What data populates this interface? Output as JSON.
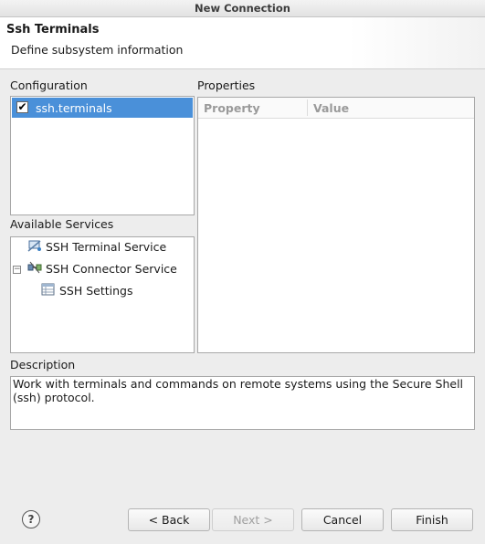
{
  "window": {
    "title": "New Connection"
  },
  "header": {
    "title": "Ssh Terminals",
    "subtitle": "Define subsystem information"
  },
  "configuration": {
    "label": "Configuration",
    "items": [
      {
        "label": "ssh.terminals",
        "checked": true,
        "selected": true
      }
    ]
  },
  "available_services": {
    "label": "Available Services",
    "items": [
      {
        "label": "SSH Terminal Service",
        "icon": "terminal-service-icon"
      },
      {
        "label": "SSH Connector Service",
        "icon": "connector-service-icon",
        "expanded": true
      },
      {
        "label": "SSH Settings",
        "icon": "settings-table-icon"
      }
    ]
  },
  "properties": {
    "label": "Properties",
    "columns": [
      "Property",
      "Value"
    ],
    "rows": []
  },
  "description": {
    "label": "Description",
    "text": "Work with terminals and commands on remote systems using the Secure Shell (ssh) protocol."
  },
  "buttons": {
    "help": "?",
    "back": "< Back",
    "next": "Next >",
    "cancel": "Cancel",
    "finish": "Finish"
  },
  "colors": {
    "selection": "#4a90d9",
    "background": "#ededed"
  }
}
